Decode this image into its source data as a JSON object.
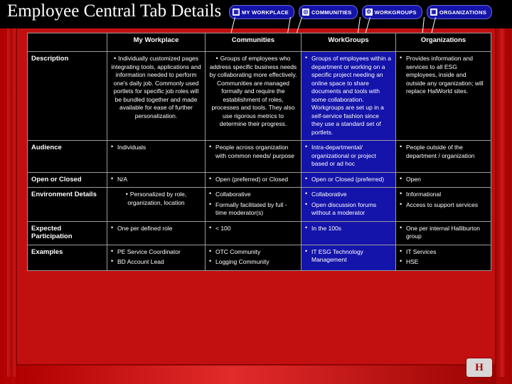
{
  "title": "Employee Central Tab Details",
  "tabs": [
    {
      "label": "MY WORKPLACE",
      "icon": "grid-icon",
      "glyph": "▦"
    },
    {
      "label": "COMMUNITIES",
      "icon": "people-icon",
      "glyph": "◎"
    },
    {
      "label": "WORKGROUPS",
      "icon": "gear-icon",
      "glyph": "⚙"
    },
    {
      "label": "ORGANIZATIONS",
      "icon": "building-icon",
      "glyph": "▣"
    }
  ],
  "table": {
    "columns": [
      "My Workplace",
      "Communities",
      "WorkGroups",
      "Organizations"
    ],
    "rows": [
      {
        "header": "Description",
        "cells": [
          [
            "Individually customized pages integrating tools, applications and information needed to perform one's daily job.  Commonly used portlets for specific job roles will be bundled together and made available for ease of further personalization."
          ],
          [
            "Groups of employees who address specific business needs by collaborating more effectively.  Communities are managed formally and require the establishment of roles, processes and tools.  They also use rigorous metrics to determine their progress."
          ],
          [
            "Groups of employees within a department or working on a specific project needing an online space to share documents and tools with some collaboration. Workgroups are set up in a self-service fashion since they use a standard set of portlets."
          ],
          [
            "Provides information and services to all ESG employees, inside and outside any organization; will replace HalWorld sites."
          ]
        ]
      },
      {
        "header": "Audience",
        "cells": [
          [
            "Individuals"
          ],
          [
            "People across organization with common needs/ purpose"
          ],
          [
            "Intra-departmental/ organizational or project based or ad hoc"
          ],
          [
            "People outside of the department / organization"
          ]
        ]
      },
      {
        "header": "Open or Closed",
        "cells": [
          [
            "N/A"
          ],
          [
            "Open (preferred) or Closed"
          ],
          [
            "Open or Closed (preferred)"
          ],
          [
            "Open"
          ]
        ]
      },
      {
        "header": "Environment Details",
        "cells": [
          [
            "Personalized by role, organization, location"
          ],
          [
            "Collaborative",
            "Formally facilitated by full -time moderator(s)"
          ],
          [
            "Collaborative",
            "Open discussion forums without a moderator"
          ],
          [
            "Informational",
            "Access to support services"
          ]
        ]
      },
      {
        "header": "Expected Participation",
        "cells": [
          [
            "One per defined role"
          ],
          [
            "< 100"
          ],
          [
            "In the 100s"
          ],
          [
            "One per internal Halliburton group"
          ]
        ]
      },
      {
        "header": "Examples",
        "cells": [
          [
            "PE Service Coordinator",
            "BD Account Lead"
          ],
          [
            "OTC Community",
            "Logging Community"
          ],
          [
            "IT ESG Technology Management"
          ],
          [
            "IT Services",
            "HSE"
          ]
        ]
      }
    ]
  },
  "logo": {
    "mark": "H"
  },
  "colors": {
    "background_red": "#c20f0f",
    "panel_black": "#000000",
    "highlight_blue": "#1414aa",
    "text_white": "#ffffff"
  }
}
